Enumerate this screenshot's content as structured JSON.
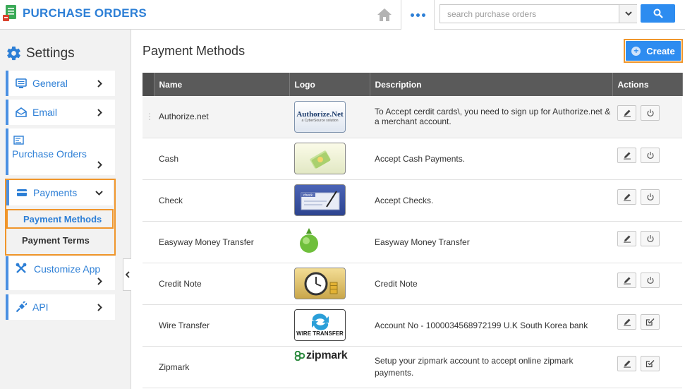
{
  "header": {
    "app_title": "PURCHASE ORDERS",
    "search_placeholder": "search purchase orders"
  },
  "sidebar": {
    "title": "Settings",
    "items": [
      {
        "label": "General",
        "icon": "monitor-icon"
      },
      {
        "label": "Email",
        "icon": "envelope-icon"
      },
      {
        "label": "Purchase Orders",
        "icon": "document-icon"
      },
      {
        "label": "Payments",
        "icon": "credit-card-icon"
      },
      {
        "label": "Customize App",
        "icon": "wrench-icon"
      },
      {
        "label": "API",
        "icon": "plug-icon"
      }
    ],
    "sub_items": [
      "Payment Methods",
      "Payment Terms"
    ]
  },
  "main": {
    "title": "Payment Methods",
    "create_label": "Create",
    "columns": [
      "Name",
      "Logo",
      "Description",
      "Actions"
    ],
    "rows": [
      {
        "name": "Authorize.net",
        "logo": "authorize-net-logo",
        "description": "To Accept cerdit cards\\, you need to sign up for Authorize.net & a merchant account.",
        "second_action": "power-icon"
      },
      {
        "name": "Cash",
        "logo": "cash-logo",
        "description": "Accept Cash Payments.",
        "second_action": "power-icon"
      },
      {
        "name": "Check",
        "logo": "check-logo",
        "description": "Accept Checks.",
        "second_action": "power-icon"
      },
      {
        "name": "Easyway Money Transfer",
        "logo": "globe-logo",
        "description": "Easyway Money Transfer",
        "second_action": "power-icon"
      },
      {
        "name": "Credit Note",
        "logo": "clock-coins-logo",
        "description": "Credit Note",
        "second_action": "power-icon"
      },
      {
        "name": "Wire Transfer",
        "logo": "wire-transfer-logo",
        "description": "Account No - 1000034568972199 U.K South Korea bank",
        "second_action": "check-square-icon"
      },
      {
        "name": "Zipmark",
        "logo": "zipmark-logo",
        "description": "Setup your zipmark account to accept online zipmark payments.",
        "second_action": "check-square-icon"
      }
    ],
    "logo_text": {
      "authorize": "Authorize.Net",
      "authorize_sub": "a CyberSource solution",
      "wire": "WIRE TRANSFER",
      "zipmark": "zipmark",
      "check": "check"
    }
  },
  "colors": {
    "accent": "#2d7fd6",
    "button_blue": "#2d8cf0",
    "highlight": "#f0962b"
  }
}
